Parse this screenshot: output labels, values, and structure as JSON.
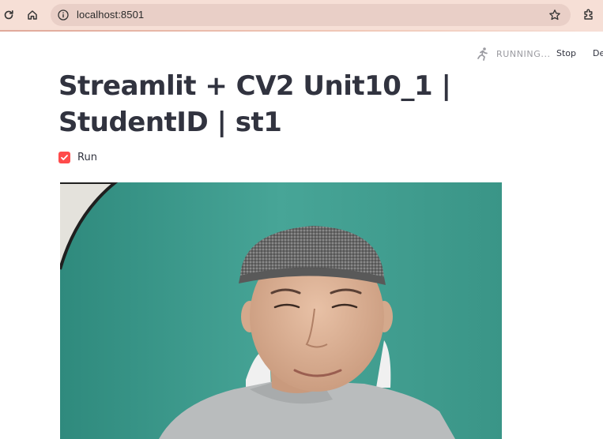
{
  "browser": {
    "url": "localhost:8501"
  },
  "toolbar": {
    "status_label": "RUNNING...",
    "stop_label": "Stop",
    "deploy_label": "Deploy"
  },
  "page": {
    "title": "Streamlit + CV2 Unit10_1 | StudentID | st1"
  },
  "run_checkbox": {
    "label": "Run",
    "checked": true
  },
  "colors": {
    "accent": "#ff4b4b",
    "text": "#31333f",
    "browser_bar": "#f6dfd6",
    "backdrop": "#3f9e90"
  }
}
